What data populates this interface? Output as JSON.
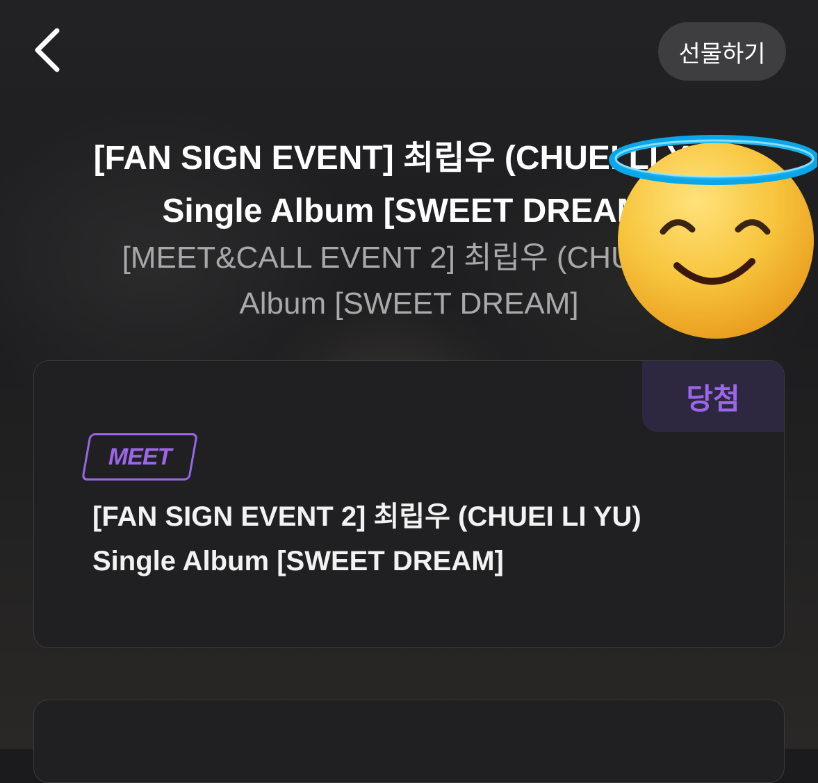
{
  "header": {
    "back_icon": "chevron-left-icon",
    "gift_label": "선물하기"
  },
  "event": {
    "title_line1": "[FAN SIGN EVENT] 최립우 (CHUEI LI YU)",
    "title_line2": "Single Album [SWEET DREAM]",
    "subtitle_line1": "[MEET&CALL EVENT 2] 최립우 (CHUEI LI",
    "subtitle_line2": "Album [SWEET DREAM]"
  },
  "card": {
    "status_badge": "당첨",
    "type_tag": "MEET",
    "title_line1": "[FAN SIGN EVENT 2] 최립우 (CHUEI LI YU)",
    "title_line2": "Single Album [SWEET DREAM]"
  },
  "sticker": {
    "icon": "smiling-face-with-halo-icon"
  },
  "colors": {
    "accent_purple": "#9a67ea",
    "badge_bg": "#2d2840",
    "card_bg": "#202022",
    "gift_bg": "#3e3e40"
  }
}
